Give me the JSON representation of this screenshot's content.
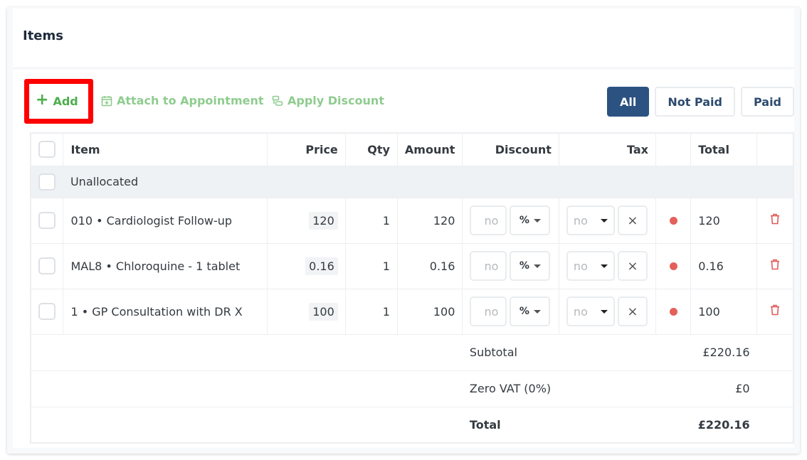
{
  "card": {
    "title": "Items"
  },
  "toolbar": {
    "add_label": "Add",
    "attach_label": "Attach to Appointment",
    "discount_label": "Apply Discount"
  },
  "filters": [
    {
      "label": "All",
      "active": true
    },
    {
      "label": "Not Paid",
      "active": false
    },
    {
      "label": "Paid",
      "active": false
    }
  ],
  "table": {
    "headers": {
      "item": "Item",
      "price": "Price",
      "qty": "Qty",
      "amount": "Amount",
      "discount": "Discount",
      "tax": "Tax",
      "total": "Total"
    },
    "group_label": "Unallocated",
    "rows": [
      {
        "item": "010 • Cardiologist Follow-up",
        "price": "120",
        "qty": "1",
        "amount": "120",
        "discount_placeholder": "no",
        "discount_type": "%",
        "tax_placeholder": "no",
        "status_color": "#e4605b",
        "total": "120"
      },
      {
        "item": "MAL8 • Chloroquine - 1 tablet",
        "price": "0.16",
        "qty": "1",
        "amount": "0.16",
        "discount_placeholder": "no",
        "discount_type": "%",
        "tax_placeholder": "no",
        "status_color": "#e4605b",
        "total": "0.16"
      },
      {
        "item": "1 • GP Consultation with DR X",
        "price": "100",
        "qty": "1",
        "amount": "100",
        "discount_placeholder": "no",
        "discount_type": "%",
        "tax_placeholder": "no",
        "status_color": "#e4605b",
        "total": "100"
      }
    ],
    "summary": {
      "subtotal_label": "Subtotal",
      "subtotal_value": "£220.16",
      "vat_label": "Zero VAT (0%)",
      "vat_value": "£0",
      "total_label": "Total",
      "total_value": "£220.16"
    }
  },
  "colors": {
    "accent": "#2c5282",
    "add_green": "#4cae4c",
    "muted_green": "#8fcc8f",
    "delete_red": "#e05a5a",
    "highlight": "#ff0000"
  }
}
